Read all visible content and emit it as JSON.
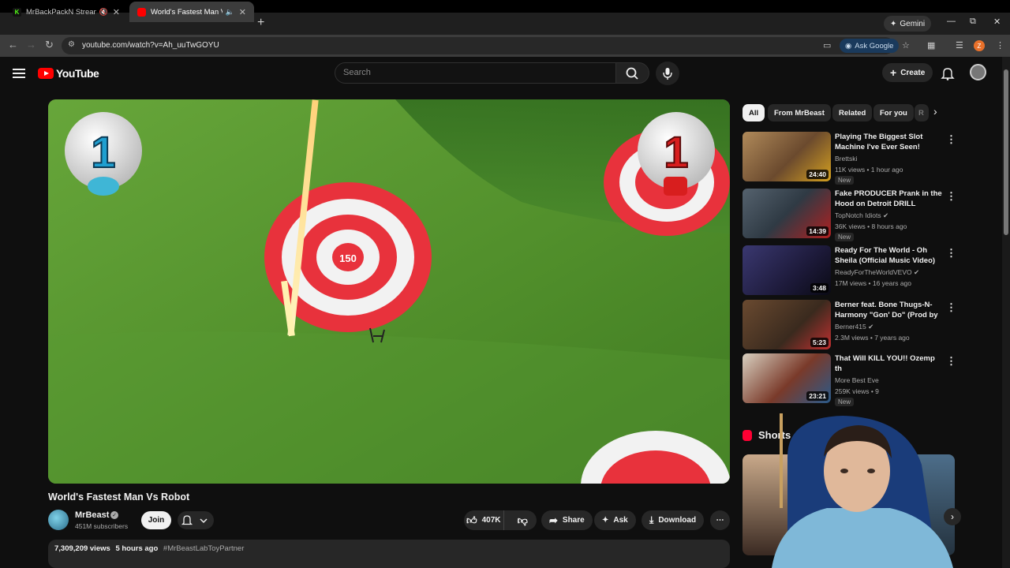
{
  "browser": {
    "tabs": [
      {
        "title": "MrBackPackN Stream - Wa",
        "favicon": "K",
        "favicon_color": "#53fc18"
      },
      {
        "title": "World's Fastest Man Vs Rob",
        "favicon": "",
        "favicon_color": "#ff0000"
      }
    ],
    "gemini_label": "Gemini",
    "url": "youtube.com/watch?v=Ah_uuTwGOYU",
    "ask_google_label": "Ask Google",
    "profile_initial": "Z"
  },
  "youtube": {
    "logo_text": "YouTube",
    "search_placeholder": "Search",
    "create_label": "Create"
  },
  "video": {
    "overlay": {
      "left_ball_number": "1",
      "right_ball_number": "1",
      "target_score": "150"
    },
    "title": "World's Fastest Man Vs Robot",
    "channel_name": "MrBeast",
    "subscribers": "451M subscribers",
    "join_label": "Join",
    "like_count": "407K",
    "share_label": "Share",
    "ask_label": "Ask",
    "download_label": "Download",
    "views": "7,309,209 views",
    "posted": "5 hours ago",
    "hashtag": "#MrBeastLabToyPartner"
  },
  "sidebar": {
    "chips": [
      "All",
      "From MrBeast",
      "Related",
      "For you",
      "R"
    ],
    "recommendations": [
      {
        "title": "Playing The Biggest Slot Machine I've Ever Seen!",
        "channel": "Brettski",
        "meta": "11K views • 1 hour ago",
        "badge": "New",
        "duration": "24:40",
        "thumb_color": "#6b4a2e"
      },
      {
        "title": "Fake PRODUCER Prank in the Hood on Detroit DRILL RAPPER!",
        "channel": "TopNotch Idiots",
        "meta": "36K views • 8 hours ago",
        "badge": "New",
        "duration": "14:39",
        "thumb_color": "#2f3a44"
      },
      {
        "title": "Ready For The World - Oh Sheila (Official Music Video)",
        "channel": "ReadyForTheWorldVEVO",
        "meta": "17M views • 16 years ago",
        "badge": "",
        "duration": "3:48",
        "thumb_color": "#1d1a3a"
      },
      {
        "title": "Berner feat. Bone Thugs-N-Harmony \"Gon' Do\" (Prod by ...",
        "channel": "Berner415",
        "meta": "2.3M views • 7 years ago",
        "badge": "",
        "duration": "5:23",
        "thumb_color": "#3a2a1e"
      },
      {
        "title": "That Will KILL YOU!! Ozemp th",
        "channel": "More Best Eve",
        "meta": "259K views • 9",
        "badge": "New",
        "duration": "23:21",
        "thumb_color": "#7a3a2a"
      }
    ],
    "shorts_label": "Shorts"
  },
  "colors": {
    "accent_red": "#ff0000",
    "background": "#0f0f0f",
    "grass": "#4f8a2b",
    "target_red": "#e8323c"
  }
}
